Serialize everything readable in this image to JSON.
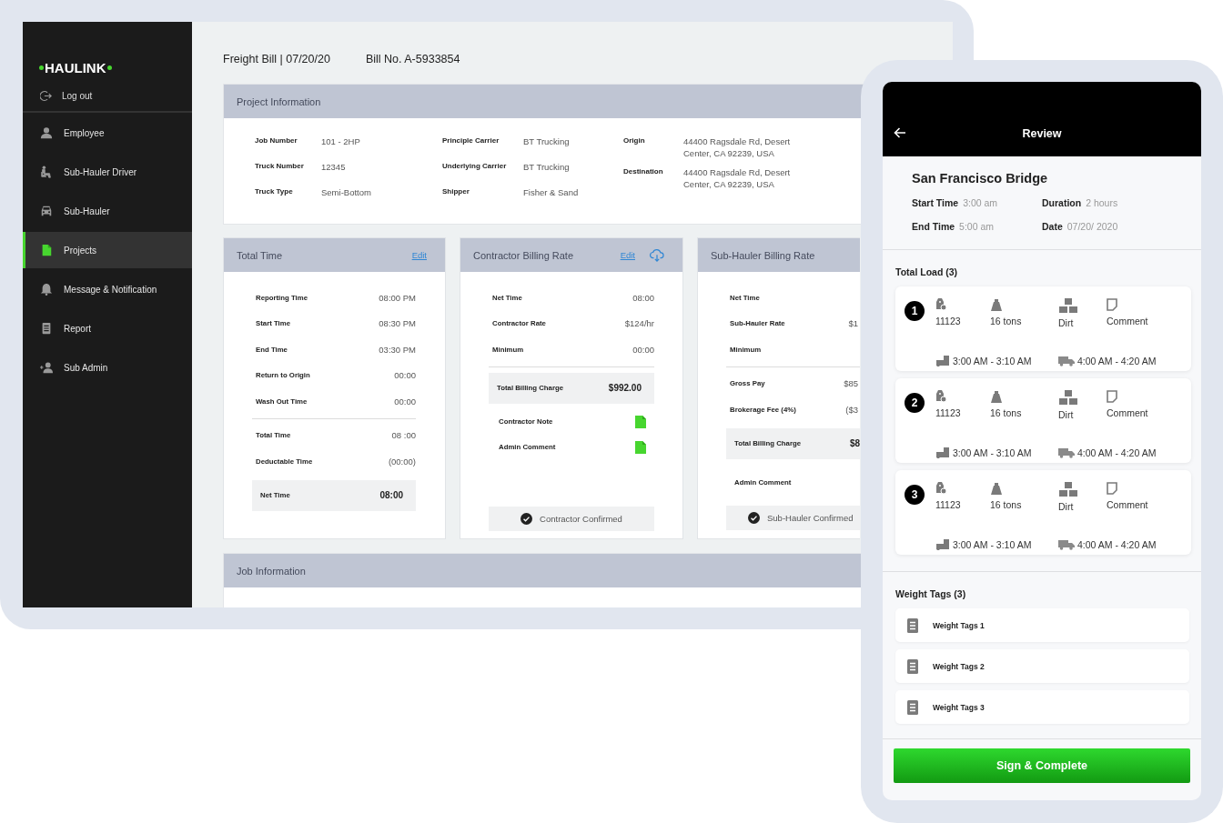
{
  "sidebar": {
    "logo": "HAULINK",
    "logout": "Log out",
    "items": [
      {
        "label": "Employee",
        "selected": false
      },
      {
        "label": "Sub-Hauler Driver",
        "selected": false
      },
      {
        "label": "Sub-Hauler",
        "selected": false
      },
      {
        "label": "Projects",
        "selected": true
      },
      {
        "label": "Message & Notification",
        "selected": false
      },
      {
        "label": "Report",
        "selected": false
      },
      {
        "label": "Sub Admin",
        "selected": false
      }
    ]
  },
  "header": {
    "title": "Freight Bill | 07/20/20",
    "bill_number": "Bill No. A-5933854"
  },
  "project_information": {
    "title": "Project Information",
    "columns": [
      [
        {
          "label": "Job Number",
          "value": "101 - 2HP"
        },
        {
          "label": "Truck Number",
          "value": "12345"
        },
        {
          "label": "Truck Type",
          "value": "Semi-Bottom"
        }
      ],
      [
        {
          "label": "Principle Carrier",
          "value": "BT Trucking"
        },
        {
          "label": "Underlying Carrier",
          "value": "BT Trucking"
        },
        {
          "label": "Shipper",
          "value": "Fisher & Sand"
        }
      ],
      [
        {
          "label": "Origin",
          "value": "44400 Ragsdale Rd, Desert Center, CA 92239, USA"
        },
        {
          "label": "Destination",
          "value": "44400 Ragsdale Rd, Desert Center, CA 92239, USA"
        }
      ]
    ]
  },
  "cards": [
    {
      "title": "Total Time",
      "edit": "Edit",
      "download_icon": false,
      "rows": [
        {
          "kind": "row",
          "label": "Reporting Time",
          "value": "08:00 PM"
        },
        {
          "kind": "row",
          "label": "Start Time",
          "value": "08:30 PM"
        },
        {
          "kind": "row",
          "label": "End Time",
          "value": "03:30 PM"
        },
        {
          "kind": "row",
          "label": "Return to Origin",
          "value": "00:00"
        },
        {
          "kind": "row",
          "label": "Wash Out Time",
          "value": "00:00"
        },
        {
          "kind": "divider"
        },
        {
          "kind": "row",
          "label": "Total Time",
          "value": "08 :00"
        },
        {
          "kind": "row",
          "label": "Deductable Time",
          "value": "(00:00)"
        },
        {
          "kind": "total",
          "label": "Net Time",
          "value": "08:00"
        }
      ]
    },
    {
      "title": "Contractor Billing Rate",
      "edit": "Edit",
      "download_icon": true,
      "rows": [
        {
          "kind": "row",
          "label": "Net Time",
          "value": "08:00"
        },
        {
          "kind": "row",
          "label": "Contractor Rate",
          "value": "$124/hr"
        },
        {
          "kind": "row",
          "label": "Minimum",
          "value": "00:00"
        },
        {
          "kind": "divider"
        },
        {
          "kind": "total",
          "label": "Total Billing Charge",
          "value": "$992.00"
        },
        {
          "kind": "note",
          "label": "Contractor Note"
        },
        {
          "kind": "note",
          "label": "Admin Comment"
        }
      ],
      "confirm": "Contractor Confirmed"
    },
    {
      "title": "Sub-Hauler Billing Rate",
      "download_icon": false,
      "rows": [
        {
          "kind": "row",
          "label": "Net Time"
        },
        {
          "kind": "row",
          "label": "Sub-Hauler Rate",
          "value": "$1"
        },
        {
          "kind": "row",
          "label": "Minimum"
        },
        {
          "kind": "divider"
        },
        {
          "kind": "row",
          "label": "Gross Pay",
          "value": "$85"
        },
        {
          "kind": "row",
          "label": "Brokerage Fee (4%)",
          "value": "($3"
        },
        {
          "kind": "total",
          "label": "Total Billing Charge",
          "value": "$8"
        },
        {
          "kind": "comment",
          "label": "Admin Comment"
        }
      ],
      "confirm": "Sub-Hauler Confirmed"
    }
  ],
  "job_information": {
    "title": "Job Information"
  },
  "phone": {
    "title": "Review",
    "project": {
      "name": "San Francisco Bridge",
      "fields": [
        {
          "label": "Start Time",
          "value": "3:00 am"
        },
        {
          "label": "Duration",
          "value": "2 hours"
        },
        {
          "label": "End Time",
          "value": "5:00 am"
        },
        {
          "label": "Date",
          "value": "07/20/ 2020"
        }
      ]
    },
    "total_load": {
      "title": "Total Load (3)",
      "loads": [
        {
          "number": "1",
          "tag": "11123",
          "weight": "16 tons",
          "material": "Dirt",
          "comment": "Comment",
          "load_time": "3:00 AM - 3:10 AM",
          "dump_time": "4:00 AM - 4:20 AM"
        },
        {
          "number": "2",
          "tag": "11123",
          "weight": "16 tons",
          "material": "Dirt",
          "comment": "Comment",
          "load_time": "3:00 AM - 3:10 AM",
          "dump_time": "4:00 AM - 4:20 AM"
        },
        {
          "number": "3",
          "tag": "11123",
          "weight": "16 tons",
          "material": "Dirt",
          "comment": "Comment",
          "load_time": "3:00 AM - 3:10 AM",
          "dump_time": "4:00 AM - 4:20 AM"
        }
      ]
    },
    "weight_tags": {
      "title": "Weight Tags (3)",
      "items": [
        "Weight Tags 1",
        "Weight Tags 2",
        "Weight Tags 3"
      ]
    },
    "button": "Sign & Complete"
  }
}
